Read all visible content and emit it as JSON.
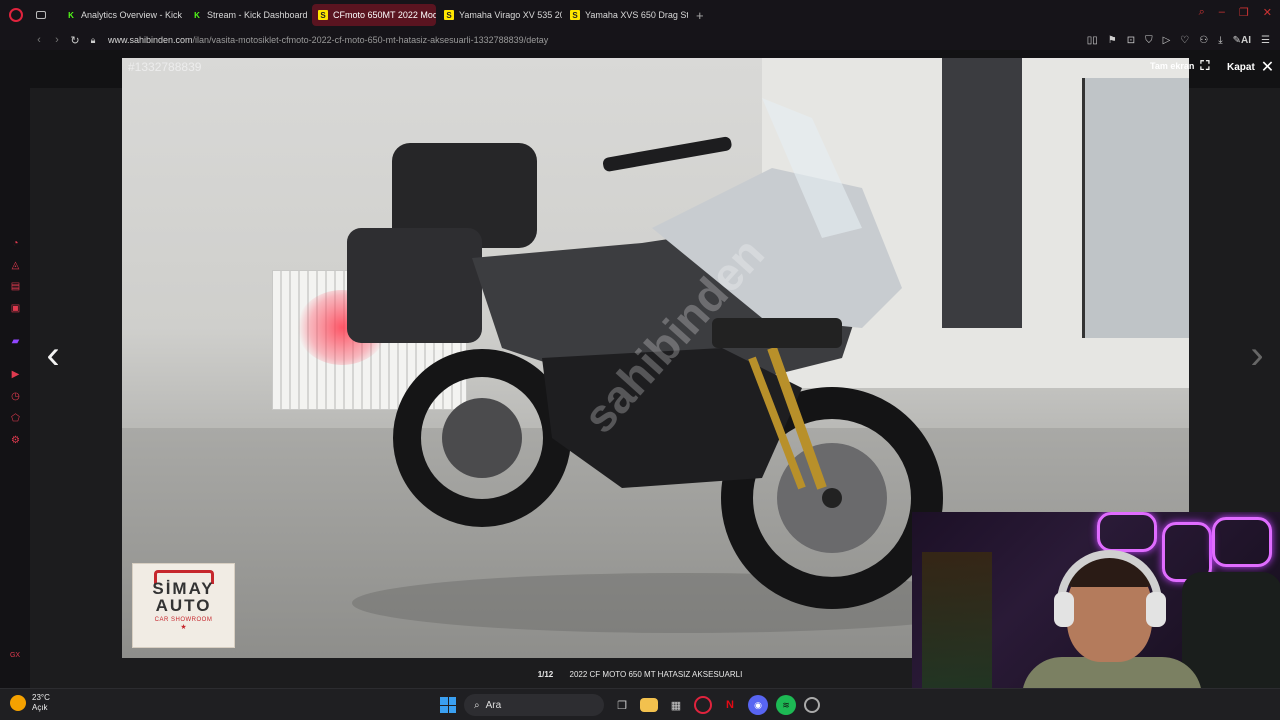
{
  "browser": {
    "tabs": [
      {
        "label": "Analytics Overview - Kick D",
        "favicon": "kick-icon",
        "active": false
      },
      {
        "label": "Stream - Kick Dashboard",
        "favicon": "kick-icon",
        "active": false
      },
      {
        "label": "CFmoto 650MT 2022 Mod",
        "favicon": "sahibinden-icon",
        "active": true
      },
      {
        "label": "Yamaha Virago XV 535 20",
        "favicon": "sahibinden-icon",
        "active": false
      },
      {
        "label": "Yamaha XVS 650 Drag Sta",
        "favicon": "sahibinden-icon",
        "active": false
      }
    ],
    "url_domain": "www.sahibinden.com",
    "url_path": "/ilan/vasita-motosiklet-cfmoto-2022-cf-moto-650-mt-hatasiz-aksesuarli-1332788839/detay",
    "toolbar_ai_label": "AI",
    "accent_color": "#e0233d"
  },
  "gallery": {
    "listing_id": "#1332788839",
    "fullscreen_label": "Tam ekran",
    "close_label": "Kapat",
    "counter": "1/12",
    "title": "2022 CF MOTO 650 MT HATASIZ AKSESUARLI",
    "watermark": "sahibinden",
    "dealer_logo": {
      "line1": "SİMAY",
      "line2": "AUTO",
      "tagline": "CAR SHOWROOM"
    }
  },
  "taskbar": {
    "temperature": "23°C",
    "weather_status": "Açık",
    "search_placeholder": "Ara"
  }
}
